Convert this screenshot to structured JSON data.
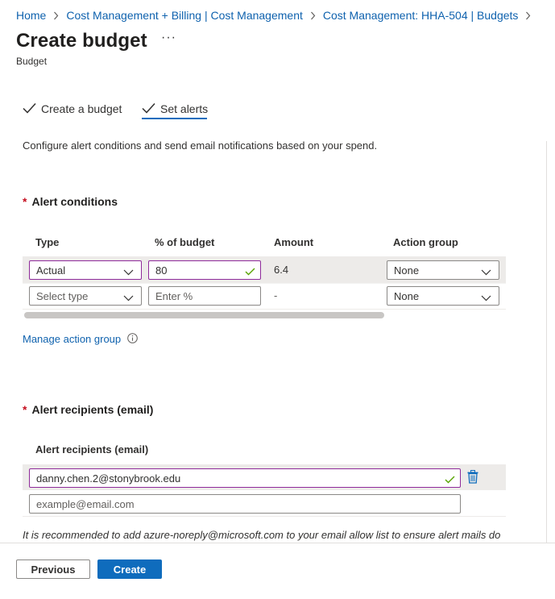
{
  "breadcrumb": [
    {
      "label": "Home"
    },
    {
      "label": "Cost Management + Billing | Cost Management"
    },
    {
      "label": "Cost Management: HHA-504 | Budgets"
    }
  ],
  "header": {
    "title": "Create budget",
    "more": "···",
    "subtitle": "Budget"
  },
  "tabs": [
    {
      "label": "Create a budget",
      "state": "completed"
    },
    {
      "label": "Set alerts",
      "state": "active"
    }
  ],
  "description": "Configure alert conditions and send email notifications based on your spend.",
  "alert_conditions": {
    "required": "*",
    "title": "Alert conditions",
    "columns": [
      "Type",
      "% of budget",
      "Amount",
      "Action group"
    ],
    "rows": [
      {
        "type": "Actual",
        "type_placeholder": "",
        "percent": "80",
        "percent_placeholder": "",
        "amount": "6.4",
        "action_group": "None"
      },
      {
        "type": "",
        "type_placeholder": "Select type",
        "percent": "",
        "percent_placeholder": "Enter %",
        "amount": "-",
        "action_group": "None"
      }
    ],
    "manage_link": "Manage action group"
  },
  "alert_recipients": {
    "required": "*",
    "title": "Alert recipients (email)",
    "column": "Alert recipients (email)",
    "emails": [
      {
        "value": "danny.chen.2@stonybrook.edu",
        "placeholder": ""
      },
      {
        "value": "",
        "placeholder": "example@email.com"
      }
    ],
    "note": "It is recommended to add azure-noreply@microsoft.com to your email allow list to ensure alert mails do"
  },
  "footer": {
    "previous_label": "Previous",
    "create_label": "Create"
  },
  "colors": {
    "link": "#0f62ae",
    "primary": "#0f6cbd",
    "focus_border": "#8e2a9a",
    "valid_check": "#57a300",
    "required": "#c50f1f"
  },
  "icons": [
    "chevron-right-icon",
    "ellipsis-icon",
    "checkmark-icon",
    "chevron-down-icon",
    "info-icon",
    "trash-icon"
  ]
}
